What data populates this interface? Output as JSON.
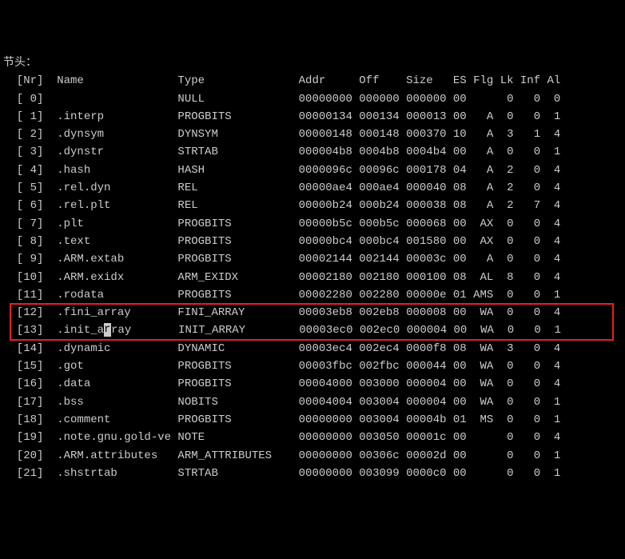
{
  "title": "节头：",
  "header": {
    "nr": "[Nr]",
    "name": "Name",
    "type": "Type",
    "addr": "Addr",
    "off": "Off",
    "size": "Size",
    "es": "ES",
    "flg": "Flg",
    "lk": "Lk",
    "inf": "Inf",
    "al": "Al"
  },
  "rows": [
    {
      "nr": "[ 0]",
      "name": "",
      "type": "NULL",
      "addr": "00000000",
      "off": "000000",
      "size": "000000",
      "es": "00",
      "flg": "",
      "lk": "0",
      "inf": "0",
      "al": "0"
    },
    {
      "nr": "[ 1]",
      "name": ".interp",
      "type": "PROGBITS",
      "addr": "00000134",
      "off": "000134",
      "size": "000013",
      "es": "00",
      "flg": "A",
      "lk": "0",
      "inf": "0",
      "al": "1"
    },
    {
      "nr": "[ 2]",
      "name": ".dynsym",
      "type": "DYNSYM",
      "addr": "00000148",
      "off": "000148",
      "size": "000370",
      "es": "10",
      "flg": "A",
      "lk": "3",
      "inf": "1",
      "al": "4"
    },
    {
      "nr": "[ 3]",
      "name": ".dynstr",
      "type": "STRTAB",
      "addr": "000004b8",
      "off": "0004b8",
      "size": "0004b4",
      "es": "00",
      "flg": "A",
      "lk": "0",
      "inf": "0",
      "al": "1"
    },
    {
      "nr": "[ 4]",
      "name": ".hash",
      "type": "HASH",
      "addr": "0000096c",
      "off": "00096c",
      "size": "000178",
      "es": "04",
      "flg": "A",
      "lk": "2",
      "inf": "0",
      "al": "4"
    },
    {
      "nr": "[ 5]",
      "name": ".rel.dyn",
      "type": "REL",
      "addr": "00000ae4",
      "off": "000ae4",
      "size": "000040",
      "es": "08",
      "flg": "A",
      "lk": "2",
      "inf": "0",
      "al": "4"
    },
    {
      "nr": "[ 6]",
      "name": ".rel.plt",
      "type": "REL",
      "addr": "00000b24",
      "off": "000b24",
      "size": "000038",
      "es": "08",
      "flg": "A",
      "lk": "2",
      "inf": "7",
      "al": "4"
    },
    {
      "nr": "[ 7]",
      "name": ".plt",
      "type": "PROGBITS",
      "addr": "00000b5c",
      "off": "000b5c",
      "size": "000068",
      "es": "00",
      "flg": "AX",
      "lk": "0",
      "inf": "0",
      "al": "4"
    },
    {
      "nr": "[ 8]",
      "name": ".text",
      "type": "PROGBITS",
      "addr": "00000bc4",
      "off": "000bc4",
      "size": "001580",
      "es": "00",
      "flg": "AX",
      "lk": "0",
      "inf": "0",
      "al": "4"
    },
    {
      "nr": "[ 9]",
      "name": ".ARM.extab",
      "type": "PROGBITS",
      "addr": "00002144",
      "off": "002144",
      "size": "00003c",
      "es": "00",
      "flg": "A",
      "lk": "0",
      "inf": "0",
      "al": "4"
    },
    {
      "nr": "[10]",
      "name": ".ARM.exidx",
      "type": "ARM_EXIDX",
      "addr": "00002180",
      "off": "002180",
      "size": "000100",
      "es": "08",
      "flg": "AL",
      "lk": "8",
      "inf": "0",
      "al": "4"
    },
    {
      "nr": "[11]",
      "name": ".rodata",
      "type": "PROGBITS",
      "addr": "00002280",
      "off": "002280",
      "size": "00000e",
      "es": "01",
      "flg": "AMS",
      "lk": "0",
      "inf": "0",
      "al": "1"
    },
    {
      "nr": "[12]",
      "name": ".fini_array",
      "type": "FINI_ARRAY",
      "addr": "00003eb8",
      "off": "002eb8",
      "size": "000008",
      "es": "00",
      "flg": "WA",
      "lk": "0",
      "inf": "0",
      "al": "4"
    },
    {
      "nr": "[13]",
      "name": ".init_array",
      "type": "INIT_ARRAY",
      "addr": "00003ec0",
      "off": "002ec0",
      "size": "000004",
      "es": "00",
      "flg": "WA",
      "lk": "0",
      "inf": "0",
      "al": "1"
    },
    {
      "nr": "[14]",
      "name": ".dynamic",
      "type": "DYNAMIC",
      "addr": "00003ec4",
      "off": "002ec4",
      "size": "0000f8",
      "es": "08",
      "flg": "WA",
      "lk": "3",
      "inf": "0",
      "al": "4"
    },
    {
      "nr": "[15]",
      "name": ".got",
      "type": "PROGBITS",
      "addr": "00003fbc",
      "off": "002fbc",
      "size": "000044",
      "es": "00",
      "flg": "WA",
      "lk": "0",
      "inf": "0",
      "al": "4"
    },
    {
      "nr": "[16]",
      "name": ".data",
      "type": "PROGBITS",
      "addr": "00004000",
      "off": "003000",
      "size": "000004",
      "es": "00",
      "flg": "WA",
      "lk": "0",
      "inf": "0",
      "al": "4"
    },
    {
      "nr": "[17]",
      "name": ".bss",
      "type": "NOBITS",
      "addr": "00004004",
      "off": "003004",
      "size": "000004",
      "es": "00",
      "flg": "WA",
      "lk": "0",
      "inf": "0",
      "al": "1"
    },
    {
      "nr": "[18]",
      "name": ".comment",
      "type": "PROGBITS",
      "addr": "00000000",
      "off": "003004",
      "size": "00004b",
      "es": "01",
      "flg": "MS",
      "lk": "0",
      "inf": "0",
      "al": "1"
    },
    {
      "nr": "[19]",
      "name": ".note.gnu.gold-ve",
      "type": "NOTE",
      "addr": "00000000",
      "off": "003050",
      "size": "00001c",
      "es": "00",
      "flg": "",
      "lk": "0",
      "inf": "0",
      "al": "4"
    },
    {
      "nr": "[20]",
      "name": ".ARM.attributes",
      "type": "ARM_ATTRIBUTES",
      "addr": "00000000",
      "off": "00306c",
      "size": "00002d",
      "es": "00",
      "flg": "",
      "lk": "0",
      "inf": "0",
      "al": "1"
    },
    {
      "nr": "[21]",
      "name": ".shstrtab",
      "type": "STRTAB",
      "addr": "00000000",
      "off": "003099",
      "size": "0000c0",
      "es": "00",
      "flg": "",
      "lk": "0",
      "inf": "0",
      "al": "1"
    }
  ],
  "highlighted_rows": [
    12,
    13
  ],
  "cursor_row": 13,
  "cursor_char_index": 7
}
